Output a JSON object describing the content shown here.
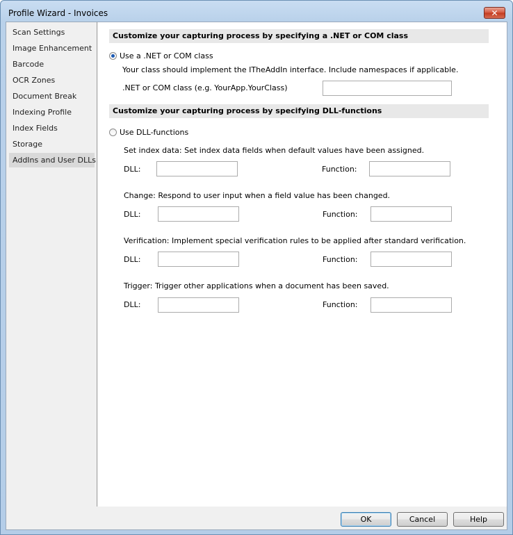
{
  "window": {
    "title": "Profile Wizard - Invoices",
    "close_glyph": "✕"
  },
  "sidebar": {
    "items": [
      {
        "label": "Scan Settings",
        "active": false
      },
      {
        "label": "Image Enhancement",
        "active": false
      },
      {
        "label": "Barcode",
        "active": false
      },
      {
        "label": "OCR Zones",
        "active": false
      },
      {
        "label": "Document Break",
        "active": false
      },
      {
        "label": "Indexing Profile",
        "active": false
      },
      {
        "label": "Index Fields",
        "active": false
      },
      {
        "label": "Storage",
        "active": false
      },
      {
        "label": "AddIns and User DLLs",
        "active": true
      }
    ]
  },
  "net_section": {
    "header": "Customize your capturing process by specifying a .NET or COM class",
    "radio_label": "Use a .NET or COM class",
    "radio_checked": true,
    "description": "Your class should implement the ITheAddIn interface. Include namespaces if applicable.",
    "class_label": ".NET or COM class (e.g. YourApp.YourClass)",
    "class_value": ""
  },
  "dll_section": {
    "header": "Customize your capturing process by specifying DLL-functions",
    "radio_label": "Use DLL-functions",
    "radio_checked": false,
    "dll_label": "DLL:",
    "function_label": "Function:",
    "groups": [
      {
        "description": "Set index data: Set index data fields when default values have been assigned.",
        "dll": "",
        "function": ""
      },
      {
        "description": "Change: Respond to user input when a field value has been changed.",
        "dll": "",
        "function": ""
      },
      {
        "description": "Verification: Implement special verification rules to be applied after standard verification.",
        "dll": "",
        "function": ""
      },
      {
        "description": "Trigger: Trigger other applications when a document has been saved.",
        "dll": "",
        "function": ""
      }
    ]
  },
  "footer": {
    "ok": "OK",
    "cancel": "Cancel",
    "help": "Help"
  }
}
